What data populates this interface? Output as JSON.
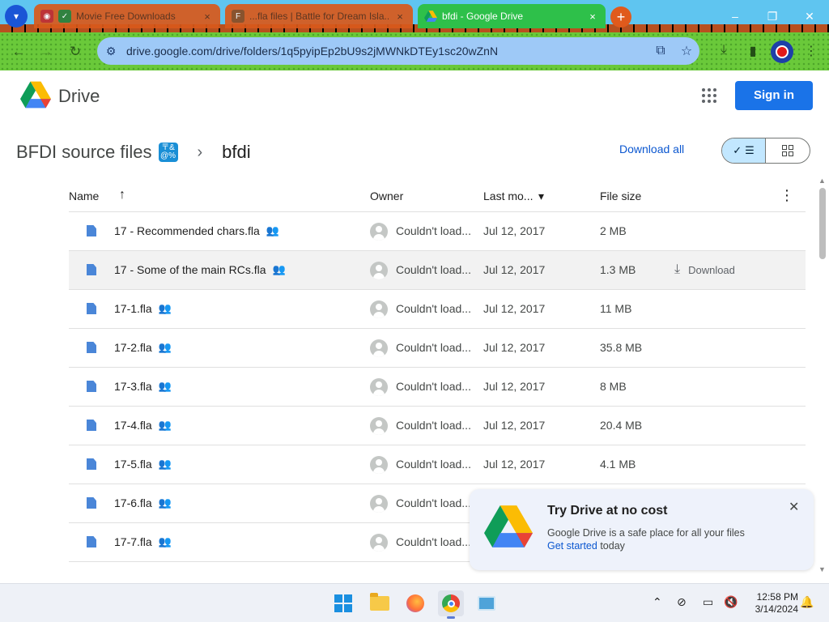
{
  "browser": {
    "tabs": [
      {
        "title": "Movie Free Downloads",
        "state": "inactive"
      },
      {
        "title": "...fla files | Battle for Dream Isla...",
        "state": "inactive"
      },
      {
        "title": "bfdi - Google Drive",
        "state": "active"
      }
    ],
    "tab_close_glyph": "×",
    "new_tab_glyph": "+",
    "window_controls": {
      "minimize": "–",
      "restore": "❐",
      "close": "✕"
    },
    "nav": {
      "back": "←",
      "forward": "→",
      "reload": "↻"
    },
    "url": "drive.google.com/drive/folders/1q5pyipEp2bU9s2jMWNkDTEy1sc20wZnN",
    "omnibox_icons": [
      "site-info-icon",
      "install-app-icon",
      "bookmark-star-icon"
    ],
    "toolbar_icons": [
      "download-icon",
      "side-panel-icon",
      "profile-avatar",
      "menu-icon"
    ],
    "colors": {
      "tab_active": "#2ec04a",
      "tab_inactive": "#d9591b",
      "toolbar": "#6ac93a",
      "omnibox": "#9ec9f7"
    }
  },
  "drive": {
    "app_name": "Drive",
    "signin_label": "Sign in",
    "breadcrumb": {
      "parent": "BFDI source files",
      "separator": "›",
      "current": "bfdi"
    },
    "download_all_label": "Download all",
    "view": {
      "mode": "list",
      "check_glyph": "✓",
      "list_glyph": "☰"
    },
    "columns": {
      "name": "Name",
      "sort_arrow": "↑",
      "owner": "Owner",
      "modified": "Last mo...",
      "modified_sort": "▾",
      "size": "File size",
      "more": "⋮"
    },
    "files": [
      {
        "name": "17 - Recommended chars.fla",
        "owner": "Couldn't load...",
        "modified": "Jul 12, 2017",
        "size": "2 MB"
      },
      {
        "name": "17 - Some of the main RCs.fla",
        "owner": "Couldn't load...",
        "modified": "Jul 12, 2017",
        "size": "1.3 MB",
        "hover_action": "Download"
      },
      {
        "name": "17-1.fla",
        "owner": "Couldn't load...",
        "modified": "Jul 12, 2017",
        "size": "11 MB"
      },
      {
        "name": "17-2.fla",
        "owner": "Couldn't load...",
        "modified": "Jul 12, 2017",
        "size": "35.8 MB"
      },
      {
        "name": "17-3.fla",
        "owner": "Couldn't load...",
        "modified": "Jul 12, 2017",
        "size": "8 MB"
      },
      {
        "name": "17-4.fla",
        "owner": "Couldn't load...",
        "modified": "Jul 12, 2017",
        "size": "20.4 MB"
      },
      {
        "name": "17-5.fla",
        "owner": "Couldn't load...",
        "modified": "Jul 12, 2017",
        "size": "4.1 MB"
      },
      {
        "name": "17-6.fla",
        "owner": "Couldn't load...",
        "modified": "",
        "size": ""
      },
      {
        "name": "17-7.fla",
        "owner": "Couldn't load...",
        "modified": "",
        "size": ""
      }
    ],
    "promo": {
      "title": "Try Drive at no cost",
      "body": "Google Drive is a safe place for all your files",
      "link": "Get started",
      "link_suffix": "today",
      "close_glyph": "✕"
    },
    "colors": {
      "primary": "#1a73e8",
      "link": "#0b57d0",
      "file_icon": "#4a86d8",
      "toggle_selected": "#c2e7ff"
    }
  },
  "taskbar": {
    "apps": [
      "start-button",
      "file-explorer",
      "firefox",
      "chrome",
      "remote-desktop"
    ],
    "active_app": "chrome",
    "tray_icons": [
      "show-hidden-icons",
      "network-off-icon",
      "display-icon",
      "volume-muted-icon",
      "notifications-icon"
    ],
    "time": "12:58 PM",
    "date": "3/14/2024"
  }
}
